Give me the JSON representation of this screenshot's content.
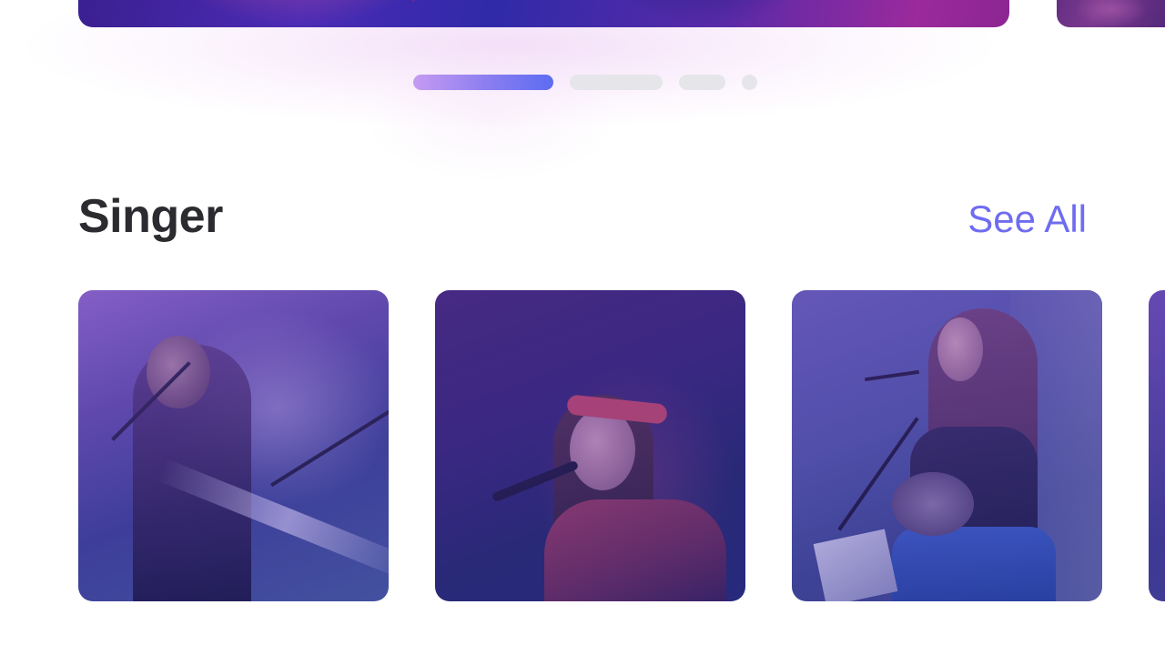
{
  "carousel": {
    "slides": [
      "slide-1",
      "slide-2",
      "slide-3",
      "slide-4"
    ],
    "active_index": 0
  },
  "section": {
    "title": "Singer",
    "see_all_label": "See All"
  },
  "singers": [
    {
      "id": "card-1"
    },
    {
      "id": "card-2"
    },
    {
      "id": "card-3"
    },
    {
      "id": "card-4"
    }
  ],
  "colors": {
    "accent": "#6f6cf0",
    "title_text": "#2b2b30",
    "indicator_inactive": "#e6e6ea",
    "indicator_active_start": "#c69bf2",
    "indicator_active_end": "#5c6cf2"
  }
}
